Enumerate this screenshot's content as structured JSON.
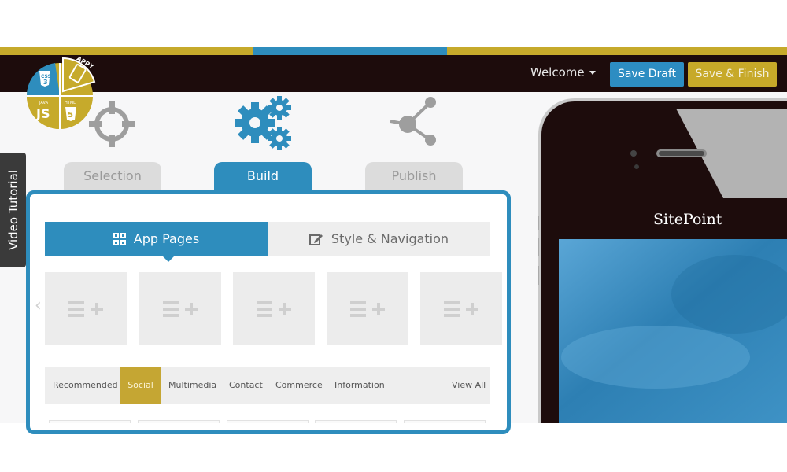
{
  "colors": {
    "accent_blue": "#2e8dbd",
    "accent_gold": "#c5a633",
    "header_bg": "#1d0c0c",
    "tab_inactive": "#dcdcdc"
  },
  "logo": {
    "pieces": [
      "CSS 3",
      "APPY",
      "JAVA JS",
      "HTML 5"
    ]
  },
  "header": {
    "welcome_label": "Welcome",
    "save_draft_label": "Save Draft",
    "save_finish_label": "Save & Finish"
  },
  "steps": [
    {
      "label": "Selection",
      "icon": "crosshair-icon",
      "active": false
    },
    {
      "label": "Build",
      "icon": "gears-icon",
      "active": true
    },
    {
      "label": "Publish",
      "icon": "share-icon",
      "active": false
    }
  ],
  "side_tab": {
    "label": "Video Tutorial"
  },
  "subtabs": [
    {
      "label": "App Pages",
      "icon": "grid-icon",
      "active": true
    },
    {
      "label": "Style & Navigation",
      "icon": "edit-icon",
      "active": false
    }
  ],
  "page_tiles": {
    "count_visible": 5,
    "tile_icon": "add-page-icon"
  },
  "categories": {
    "items": [
      "Recommended",
      "Social",
      "Multimedia",
      "Contact",
      "Commerce",
      "Information"
    ],
    "active": "Social",
    "view_all_label": "View All"
  },
  "phone": {
    "app_title": "SitePoint"
  }
}
